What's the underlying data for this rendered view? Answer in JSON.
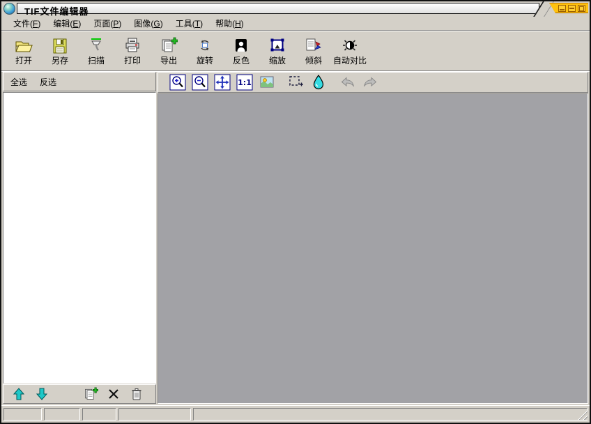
{
  "window": {
    "title": "TIF文件编辑器",
    "controls": [
      {
        "id": "minimize",
        "icon": "win-minimize-icon"
      },
      {
        "id": "maximize",
        "icon": "win-maximize-icon"
      },
      {
        "id": "close",
        "icon": "win-close-icon"
      }
    ]
  },
  "menu_bar": {
    "items": [
      {
        "id": "file",
        "label": "文件",
        "mnemonic": "F"
      },
      {
        "id": "edit",
        "label": "编辑",
        "mnemonic": "E"
      },
      {
        "id": "page",
        "label": "页面",
        "mnemonic": "P"
      },
      {
        "id": "image",
        "label": "图像",
        "mnemonic": "G"
      },
      {
        "id": "tools",
        "label": "工具",
        "mnemonic": "T"
      },
      {
        "id": "help",
        "label": "帮助",
        "mnemonic": "H"
      }
    ]
  },
  "main_toolbar": {
    "buttons": [
      {
        "id": "open",
        "label": "打开",
        "icon": "open-folder-icon"
      },
      {
        "id": "save-as",
        "label": "另存",
        "icon": "save-floppy-icon"
      },
      {
        "id": "scan",
        "label": "扫描",
        "icon": "scanner-icon"
      },
      {
        "id": "print",
        "label": "打印",
        "icon": "printer-icon"
      },
      {
        "id": "export",
        "label": "导出",
        "icon": "export-icon"
      },
      {
        "id": "rotate",
        "label": "旋转",
        "icon": "rotate-icon"
      },
      {
        "id": "invert",
        "label": "反色",
        "icon": "invert-icon"
      },
      {
        "id": "zoom",
        "label": "缩放",
        "icon": "zoom-frame-icon"
      },
      {
        "id": "deskew",
        "label": "倾斜",
        "icon": "skew-icon"
      },
      {
        "id": "auto-contrast",
        "label": "自动对比",
        "icon": "auto-contrast-icon"
      }
    ]
  },
  "page_panel": {
    "select_all_label": "全选",
    "invert_selection_label": "反选",
    "pages": [],
    "actions": [
      {
        "id": "move-up",
        "icon": "move-up-icon",
        "gap": false
      },
      {
        "id": "move-down",
        "icon": "move-down-icon",
        "gap": false
      },
      {
        "id": "copy-page",
        "icon": "copy-page-icon",
        "gap": true
      },
      {
        "id": "remove-page",
        "icon": "remove-x-icon",
        "gap": false
      },
      {
        "id": "delete-page",
        "icon": "trash-icon",
        "gap": false
      }
    ]
  },
  "view_toolbar": {
    "buttons": [
      {
        "id": "zoom-in",
        "icon": "zoom-in-icon",
        "enabled": true,
        "group": 1
      },
      {
        "id": "zoom-out",
        "icon": "zoom-out-icon",
        "enabled": true,
        "group": 1
      },
      {
        "id": "fit-window",
        "icon": "fit-window-icon",
        "enabled": true,
        "group": 1
      },
      {
        "id": "actual-size",
        "icon": "actual-size-icon",
        "enabled": true,
        "group": 1
      },
      {
        "id": "image-view",
        "icon": "image-icon",
        "enabled": true,
        "group": 1
      },
      {
        "id": "select-region",
        "icon": "select-region-icon",
        "enabled": true,
        "group": 2
      },
      {
        "id": "fill-color",
        "icon": "color-drop-icon",
        "enabled": true,
        "group": 2
      },
      {
        "id": "undo",
        "icon": "undo-icon",
        "enabled": false,
        "group": 3
      },
      {
        "id": "redo",
        "icon": "redo-icon",
        "enabled": false,
        "group": 3
      }
    ]
  },
  "status_bar": {
    "cells": [
      "",
      "",
      "",
      "",
      ""
    ]
  },
  "colors": {
    "chrome": "#d4d0c8",
    "canvas": "#a2a2a6",
    "titlebar_accent": "#ffc20e",
    "toolbar_navy": "#000080",
    "list_bg": "#ffffff"
  }
}
